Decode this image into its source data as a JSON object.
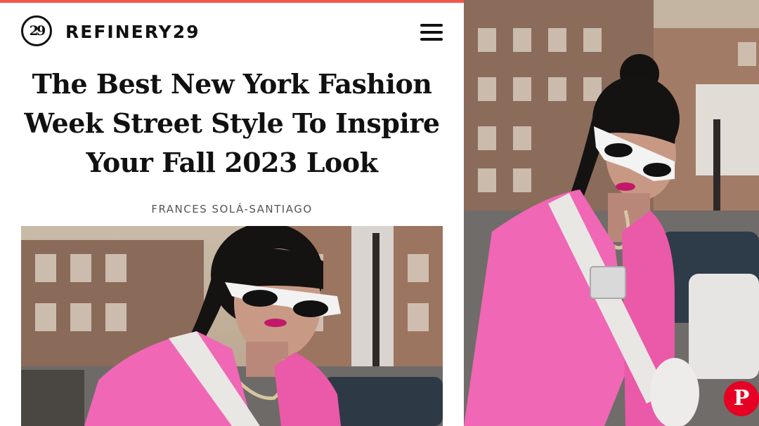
{
  "header": {
    "logo_badge": "29",
    "logo_text": "REFINERY29",
    "menu_icon": "hamburger-menu-icon"
  },
  "article": {
    "headline_lines": [
      "The Best New York Fashion",
      "Week Street Style To Inspire",
      "Your Fall 2023 Look"
    ],
    "byline": "FRANCES SOLÁ-SANTIAGO"
  },
  "share": {
    "pin_glyph": "P",
    "pin_icon": "pinterest-icon"
  },
  "colors": {
    "accent": "#f2564b",
    "pinterest": "#e60023",
    "text": "#111111",
    "byline": "#555555",
    "blazer": "#f067b5"
  }
}
